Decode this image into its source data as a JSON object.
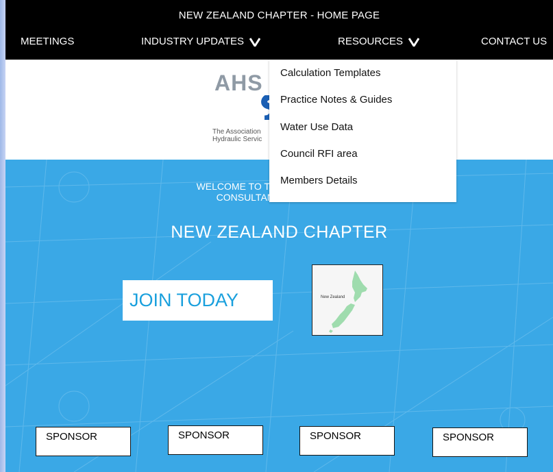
{
  "header": {
    "title": "NEW ZEALAND CHAPTER - HOME PAGE",
    "nav": [
      {
        "label": "MEETINGS"
      },
      {
        "label": "INDUSTRY UPDATES"
      },
      {
        "label": "RESOURCES"
      },
      {
        "label": "CONTACT US"
      }
    ]
  },
  "logo": {
    "text": "AHS",
    "caption_line1": "The Association",
    "caption_line2": "Hydraulic Servic"
  },
  "resources_menu": [
    "Calculation Templates",
    "Practice Notes & Guides",
    "Water Use Data",
    "Council RFI area",
    "Members Details"
  ],
  "hero": {
    "welcome_line1": "WELCOME TO THE ASSOCI",
    "welcome_line2": "CONSULTANTS AU",
    "chapter_title": "NEW ZEALAND CHAPTER",
    "join_label": "JOIN TODAY",
    "map_label": "New Zealand"
  },
  "sponsors": [
    "SPONSOR",
    "SPONSOR",
    "SPONSOR",
    "SPONSOR"
  ],
  "colors": {
    "header_bg": "#000000",
    "hero_bg": "#3aa8e6",
    "join_text": "#1aa0dd",
    "map_land": "#9fdcae"
  }
}
